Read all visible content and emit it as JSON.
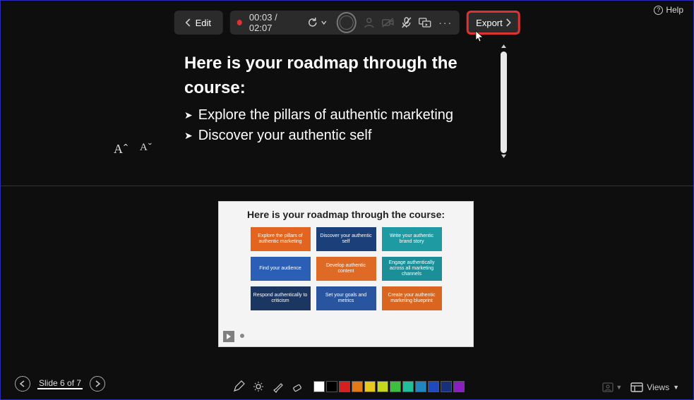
{
  "toolbar": {
    "edit_label": "Edit",
    "timer_current": "00:03",
    "timer_total": "02:07",
    "export_label": "Export"
  },
  "help_label": "Help",
  "notes": {
    "heading": "Here is your roadmap through the course:",
    "bullets": [
      "Explore the pillars of authentic marketing",
      "Discover your authentic self"
    ]
  },
  "font_controls": {
    "increase_glyph": "Aˆ",
    "decrease_glyph": "Aˇ"
  },
  "slide_preview": {
    "title": "Here is your roadmap through the course:",
    "cells": {
      "r1c1": "Explore the pillars of authentic marketing",
      "r1c2": "Discover your authentic self",
      "r1c3": "Write your authentic brand story",
      "r2c1": "Find your audience",
      "r2c2": "Develop authentic content",
      "r2c3": "Engage authentically across all marketing channels",
      "r3c1": "Respond authentically to criticism",
      "r3c2": "Set your goals and metrics",
      "r3c3": "Create your authentic marketing blueprint"
    }
  },
  "bottom": {
    "slide_counter": "Slide 6 of 7",
    "palette": [
      "#ffffff",
      "#000000",
      "#d81f1f",
      "#e27a17",
      "#e6c81f",
      "#c4d81f",
      "#3fbf3f",
      "#1fbf9b",
      "#1f86bf",
      "#1f4abf",
      "#16317a",
      "#8a1fbf"
    ],
    "views_label": "Views"
  }
}
